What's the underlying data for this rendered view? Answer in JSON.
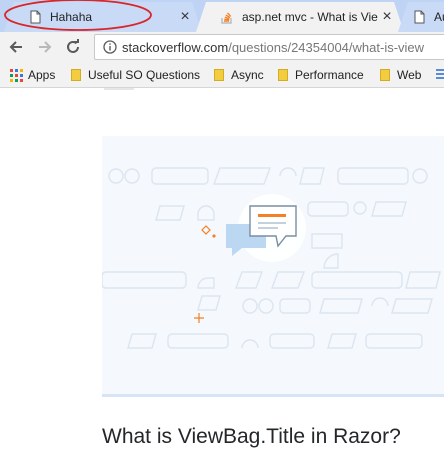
{
  "tabs": [
    {
      "label": "Hahaha",
      "close": "×",
      "active": false
    },
    {
      "label": "asp.net mvc - What is Vie",
      "close": "×",
      "active": true
    },
    {
      "label": "Au",
      "close": "",
      "active": false
    }
  ],
  "toolbar": {
    "url_host": "stackoverflow.com",
    "url_path": "/questions/24354004/what-is-view"
  },
  "bookmarks": [
    {
      "label": "Apps",
      "icon": "apps-grid-icon"
    },
    {
      "label": "Useful SO Questions",
      "icon": "folder-icon"
    },
    {
      "label": "Async",
      "icon": "folder-icon"
    },
    {
      "label": "Performance",
      "icon": "folder-icon"
    },
    {
      "label": "Web",
      "icon": "folder-icon"
    }
  ],
  "page": {
    "question_title": "What is ViewBag.Title in Razor?"
  },
  "colors": {
    "annotation": "#d9262b",
    "so_orange": "#f48024",
    "illustration_blue": "#d6e4f3"
  }
}
